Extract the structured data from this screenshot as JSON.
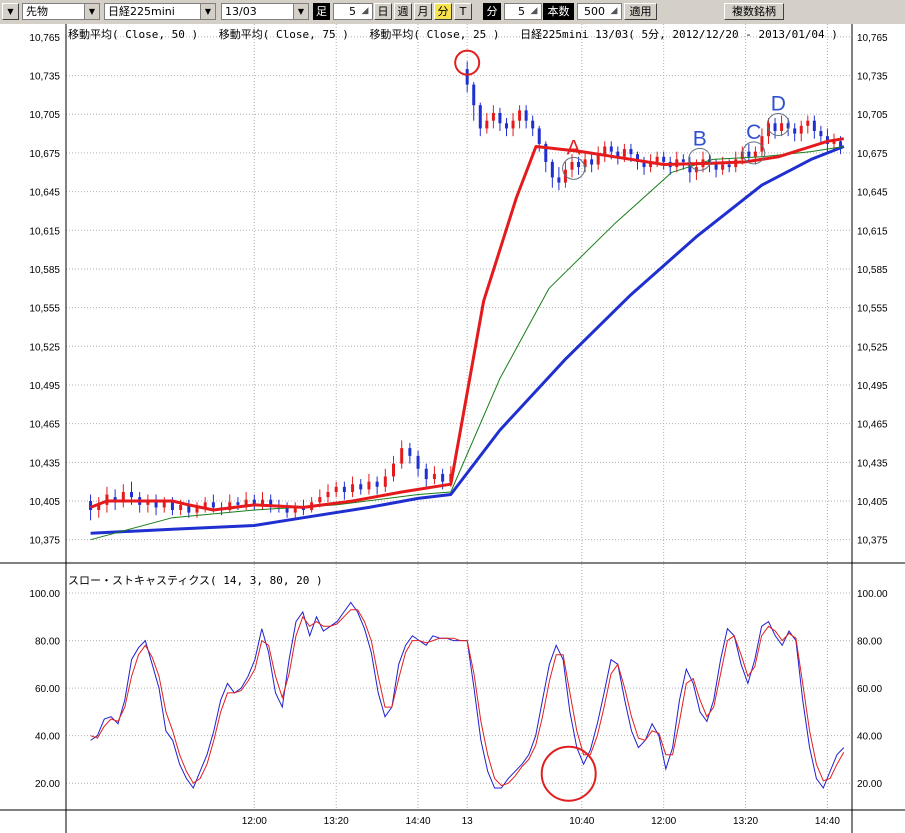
{
  "toolbar": {
    "menu_icon": "dropdown-arrow-icon",
    "market_select": "先物",
    "symbol_select": "日経225mini",
    "contract_select": "13/03",
    "bar_label": "足",
    "day_interval_value": "5",
    "btn_day": "日",
    "btn_week": "週",
    "btn_month": "月",
    "btn_minute": "分",
    "btn_tick": "T",
    "minute_label": "分",
    "minute_value": "5",
    "count_label": "本数",
    "count_value": "500",
    "apply_button": "適用",
    "multi_symbol_button": "複数銘柄",
    "active_color": "#f8e34f"
  },
  "chart_data": [
    {
      "type": "line",
      "title": "日経225mini 13/03( 5分, 2012/12/20 - 2013/01/04 )",
      "legend": [
        "移動平均( Close, 50 )",
        "移動平均( Close, 75 )",
        "移動平均( Close, 25 )"
      ],
      "y_ticks": [
        "10,765",
        "10,735",
        "10,705",
        "10,675",
        "10,645",
        "10,615",
        "10,585",
        "10,555",
        "10,525",
        "10,495",
        "10,465",
        "10,435",
        "10,405",
        "10,375"
      ],
      "ylim": [
        10360,
        10775
      ],
      "grid": true,
      "candles_note": "5-minute candlesticks (red = up, blue = down)",
      "candles": [
        [
          0,
          10405,
          10398,
          10410,
          10390
        ],
        [
          0.05,
          10398,
          10402,
          10408,
          10392
        ],
        [
          0.1,
          10402,
          10410,
          10416,
          10396
        ],
        [
          0.15,
          10408,
          10404,
          10414,
          10398
        ],
        [
          0.2,
          10404,
          10412,
          10418,
          10400
        ],
        [
          0.25,
          10412,
          10408,
          10420,
          10402
        ],
        [
          0.3,
          10408,
          10402,
          10412,
          10396
        ],
        [
          0.35,
          10402,
          10406,
          10410,
          10396
        ],
        [
          0.4,
          10406,
          10400,
          10410,
          10394
        ],
        [
          0.45,
          10400,
          10404,
          10408,
          10396
        ],
        [
          0.5,
          10404,
          10398,
          10408,
          10394
        ],
        [
          0.55,
          10398,
          10402,
          10406,
          10394
        ],
        [
          0.6,
          10402,
          10396,
          10406,
          10392
        ],
        [
          0.65,
          10396,
          10400,
          10404,
          10392
        ],
        [
          0.7,
          10400,
          10404,
          10408,
          10396
        ],
        [
          0.75,
          10404,
          10400,
          10410,
          10396
        ],
        [
          0.8,
          10400,
          10398,
          10404,
          10394
        ],
        [
          0.85,
          10398,
          10404,
          10410,
          10396
        ],
        [
          0.9,
          10404,
          10402,
          10408,
          10398
        ],
        [
          0.95,
          10402,
          10406,
          10412,
          10398
        ],
        [
          1,
          10406,
          10402,
          10410,
          10398
        ],
        [
          1.05,
          10402,
          10406,
          10412,
          10398
        ],
        [
          1.1,
          10406,
          10402,
          10410,
          10396
        ],
        [
          1.15,
          10402,
          10400,
          10406,
          10396
        ],
        [
          1.2,
          10400,
          10396,
          10404,
          10392
        ],
        [
          1.25,
          10396,
          10400,
          10404,
          10392
        ],
        [
          1.3,
          10400,
          10398,
          10406,
          10394
        ],
        [
          1.35,
          10398,
          10404,
          10408,
          10396
        ],
        [
          1.4,
          10404,
          10408,
          10414,
          10400
        ],
        [
          1.45,
          10408,
          10412,
          10418,
          10404
        ],
        [
          1.5,
          10412,
          10416,
          10420,
          10408
        ],
        [
          1.55,
          10416,
          10412,
          10420,
          10406
        ],
        [
          1.6,
          10412,
          10418,
          10424,
          10408
        ],
        [
          1.65,
          10418,
          10414,
          10422,
          10410
        ],
        [
          1.7,
          10414,
          10420,
          10426,
          10410
        ],
        [
          1.75,
          10420,
          10416,
          10424,
          10410
        ],
        [
          1.8,
          10416,
          10424,
          10430,
          10412
        ],
        [
          1.85,
          10424,
          10434,
          10440,
          10420
        ],
        [
          1.9,
          10434,
          10446,
          10452,
          10430
        ],
        [
          1.95,
          10446,
          10440,
          10450,
          10434
        ],
        [
          2,
          10440,
          10430,
          10444,
          10424
        ],
        [
          2.05,
          10430,
          10422,
          10434,
          10416
        ],
        [
          2.1,
          10422,
          10426,
          10432,
          10418
        ],
        [
          2.15,
          10426,
          10420,
          10430,
          10414
        ],
        [
          2.2,
          10420,
          10426,
          10432,
          10416
        ],
        [
          2.3,
          10740,
          10728,
          10746,
          10722
        ],
        [
          2.34,
          10728,
          10712,
          10730,
          10700
        ],
        [
          2.38,
          10712,
          10694,
          10714,
          10688
        ],
        [
          2.42,
          10694,
          10700,
          10706,
          10690
        ],
        [
          2.46,
          10700,
          10706,
          10712,
          10694
        ],
        [
          2.5,
          10706,
          10698,
          10710,
          10692
        ],
        [
          2.54,
          10698,
          10694,
          10702,
          10688
        ],
        [
          2.58,
          10694,
          10700,
          10706,
          10688
        ],
        [
          2.62,
          10700,
          10708,
          10712,
          10694
        ],
        [
          2.66,
          10708,
          10700,
          10712,
          10694
        ],
        [
          2.7,
          10700,
          10694,
          10704,
          10688
        ],
        [
          2.74,
          10694,
          10682,
          10696,
          10676
        ],
        [
          2.78,
          10682,
          10668,
          10684,
          10660
        ],
        [
          2.82,
          10668,
          10656,
          10670,
          10648
        ],
        [
          2.86,
          10656,
          10652,
          10664,
          10646
        ],
        [
          2.9,
          10652,
          10662,
          10668,
          10648
        ],
        [
          2.94,
          10662,
          10668,
          10674,
          10656
        ],
        [
          2.98,
          10668,
          10664,
          10672,
          10658
        ],
        [
          3.02,
          10664,
          10670,
          10676,
          10660
        ],
        [
          3.06,
          10670,
          10666,
          10674,
          10660
        ],
        [
          3.1,
          10666,
          10674,
          10680,
          10662
        ],
        [
          3.14,
          10674,
          10680,
          10684,
          10668
        ],
        [
          3.18,
          10680,
          10676,
          10684,
          10670
        ],
        [
          3.22,
          10676,
          10672,
          10680,
          10666
        ],
        [
          3.26,
          10672,
          10678,
          10682,
          10668
        ],
        [
          3.3,
          10678,
          10674,
          10682,
          10668
        ],
        [
          3.34,
          10674,
          10668,
          10676,
          10662
        ],
        [
          3.38,
          10668,
          10664,
          10672,
          10658
        ],
        [
          3.42,
          10664,
          10668,
          10674,
          10660
        ],
        [
          3.46,
          10668,
          10672,
          10676,
          10664
        ],
        [
          3.5,
          10672,
          10668,
          10676,
          10662
        ],
        [
          3.54,
          10668,
          10664,
          10672,
          10658
        ],
        [
          3.58,
          10664,
          10670,
          10676,
          10660
        ],
        [
          3.62,
          10670,
          10668,
          10674,
          10662
        ],
        [
          3.66,
          10668,
          10660,
          10672,
          10652
        ],
        [
          3.7,
          10660,
          10664,
          10670,
          10654
        ],
        [
          3.74,
          10664,
          10670,
          10676,
          10660
        ],
        [
          3.78,
          10670,
          10666,
          10674,
          10660
        ],
        [
          3.82,
          10666,
          10662,
          10670,
          10656
        ],
        [
          3.86,
          10662,
          10666,
          10672,
          10658
        ],
        [
          3.9,
          10666,
          10664,
          10670,
          10660
        ],
        [
          3.94,
          10664,
          10670,
          10676,
          10660
        ],
        [
          3.98,
          10670,
          10676,
          10680,
          10666
        ],
        [
          4.02,
          10676,
          10672,
          10682,
          10668
        ],
        [
          4.06,
          10672,
          10676,
          10680,
          10666
        ],
        [
          4.1,
          10676,
          10688,
          10694,
          10672
        ],
        [
          4.14,
          10688,
          10698,
          10702,
          10682
        ],
        [
          4.18,
          10698,
          10692,
          10702,
          10686
        ],
        [
          4.22,
          10692,
          10698,
          10704,
          10688
        ],
        [
          4.26,
          10698,
          10694,
          10702,
          10688
        ],
        [
          4.3,
          10694,
          10690,
          10698,
          10684
        ],
        [
          4.34,
          10690,
          10696,
          10700,
          10684
        ],
        [
          4.38,
          10696,
          10700,
          10704,
          10690
        ],
        [
          4.42,
          10700,
          10692,
          10704,
          10686
        ],
        [
          4.46,
          10692,
          10688,
          10696,
          10682
        ],
        [
          4.5,
          10688,
          10682,
          10694,
          10676
        ],
        [
          4.54,
          10682,
          10684,
          10690,
          10676
        ],
        [
          4.58,
          10684,
          10680,
          10688,
          10674
        ]
      ],
      "annotations": [
        {
          "label": "",
          "x": 2.3,
          "y": 10745,
          "color": "#e02020"
        },
        {
          "label": "A",
          "x": 2.95,
          "y": 10663,
          "color": "#e02020"
        },
        {
          "label": "B",
          "x": 3.72,
          "y": 10670,
          "color": "#3050d0"
        },
        {
          "label": "C",
          "x": 4.05,
          "y": 10675,
          "color": "#3050d0"
        },
        {
          "label": "D",
          "x": 4.2,
          "y": 10697,
          "color": "#3050d0"
        }
      ],
      "ma25": [
        [
          0,
          10400
        ],
        [
          0.1,
          10405
        ],
        [
          0.5,
          10405
        ],
        [
          0.6,
          10402
        ],
        [
          0.75,
          10398
        ],
        [
          1,
          10402
        ],
        [
          1.3,
          10400
        ],
        [
          1.6,
          10405
        ],
        [
          1.9,
          10412
        ],
        [
          2.2,
          10418
        ],
        [
          2.4,
          10560
        ],
        [
          2.6,
          10640
        ],
        [
          2.72,
          10680
        ],
        [
          3.0,
          10676
        ],
        [
          3.2,
          10672
        ],
        [
          3.5,
          10666
        ],
        [
          3.8,
          10667
        ],
        [
          4.0,
          10668
        ],
        [
          4.2,
          10672
        ],
        [
          4.4,
          10680
        ],
        [
          4.5,
          10684
        ],
        [
          4.6,
          10686
        ]
      ],
      "ma50": [
        [
          0,
          10375
        ],
        [
          0.5,
          10392
        ],
        [
          1.0,
          10398
        ],
        [
          1.5,
          10402
        ],
        [
          2.0,
          10410
        ],
        [
          2.2,
          10412
        ],
        [
          2.5,
          10500
        ],
        [
          2.8,
          10570
        ],
        [
          3.2,
          10620
        ],
        [
          3.55,
          10660
        ],
        [
          3.8,
          10670
        ],
        [
          4.1,
          10672
        ],
        [
          4.4,
          10676
        ],
        [
          4.6,
          10680
        ]
      ],
      "ma75": [
        [
          0,
          10380
        ],
        [
          0.5,
          10383
        ],
        [
          1.0,
          10386
        ],
        [
          1.3,
          10392
        ],
        [
          1.7,
          10400
        ],
        [
          2.0,
          10407
        ],
        [
          2.2,
          10410
        ],
        [
          2.5,
          10460
        ],
        [
          2.9,
          10515
        ],
        [
          3.3,
          10565
        ],
        [
          3.7,
          10610
        ],
        [
          4.1,
          10650
        ],
        [
          4.4,
          10670
        ],
        [
          4.6,
          10680
        ]
      ],
      "ma_colors": {
        "ma25": "#e41a1c",
        "ma50": "#1a7d1a",
        "ma75": "#1f2fd0"
      },
      "x_tick_labels": [
        "12:00",
        "13:20",
        "14:40",
        "13",
        "10:40",
        "12:00",
        "13:20",
        "14:40"
      ],
      "x_tick_positions": [
        1.0,
        1.5,
        2.0,
        2.3,
        3.0,
        3.5,
        4.0,
        4.5
      ],
      "xlim": [
        -0.15,
        4.65
      ]
    },
    {
      "type": "line",
      "title": "スロー・ストキャスティクス( 14, 3, 80, 20 )",
      "y_ticks": [
        "100.00",
        "80.00",
        "60.00",
        "40.00",
        "20.00"
      ],
      "ylim": [
        10,
        108
      ],
      "grid": true,
      "series": [
        {
          "name": "%D",
          "color": "#2020d0",
          "values": [
            38,
            40,
            47,
            48,
            45,
            55,
            72,
            77,
            80,
            70,
            60,
            42,
            38,
            28,
            22,
            18,
            25,
            32,
            42,
            55,
            62,
            58,
            60,
            65,
            72,
            85,
            75,
            58,
            52,
            72,
            88,
            92,
            82,
            90,
            84,
            86,
            88,
            92,
            96,
            92,
            85,
            75,
            58,
            48,
            52,
            70,
            78,
            82,
            80,
            78,
            82,
            81,
            81,
            80,
            80,
            80,
            60,
            38,
            25,
            18,
            18,
            22,
            25,
            28,
            32,
            40,
            55,
            70,
            78,
            72,
            50,
            35,
            28,
            34,
            45,
            58,
            72,
            70,
            55,
            42,
            35,
            38,
            45,
            40,
            26,
            35,
            55,
            68,
            62,
            50,
            46,
            55,
            72,
            85,
            82,
            70,
            62,
            72,
            86,
            88,
            82,
            78,
            84,
            80,
            55,
            35,
            22,
            18,
            25,
            32,
            35
          ]
        },
        {
          "name": "%K",
          "color": "#e02020",
          "values": [
            40,
            39,
            44,
            47,
            46,
            52,
            65,
            74,
            78,
            73,
            65,
            50,
            42,
            32,
            25,
            20,
            22,
            28,
            38,
            50,
            58,
            58,
            59,
            63,
            68,
            80,
            78,
            65,
            56,
            66,
            82,
            90,
            86,
            88,
            86,
            86,
            87,
            90,
            93,
            93,
            88,
            80,
            65,
            52,
            52,
            64,
            75,
            80,
            80,
            79,
            80,
            81,
            81,
            81,
            80,
            80,
            66,
            46,
            32,
            22,
            19,
            20,
            23,
            27,
            30,
            36,
            48,
            63,
            74,
            74,
            58,
            42,
            32,
            32,
            40,
            52,
            66,
            70,
            60,
            48,
            39,
            38,
            42,
            41,
            32,
            32,
            46,
            62,
            64,
            55,
            48,
            52,
            66,
            80,
            82,
            74,
            65,
            69,
            82,
            86,
            84,
            80,
            83,
            81,
            62,
            42,
            28,
            21,
            22,
            28,
            33
          ]
        }
      ],
      "circle": {
        "x": 2.92,
        "y": 24,
        "color": "#e02020"
      }
    }
  ]
}
